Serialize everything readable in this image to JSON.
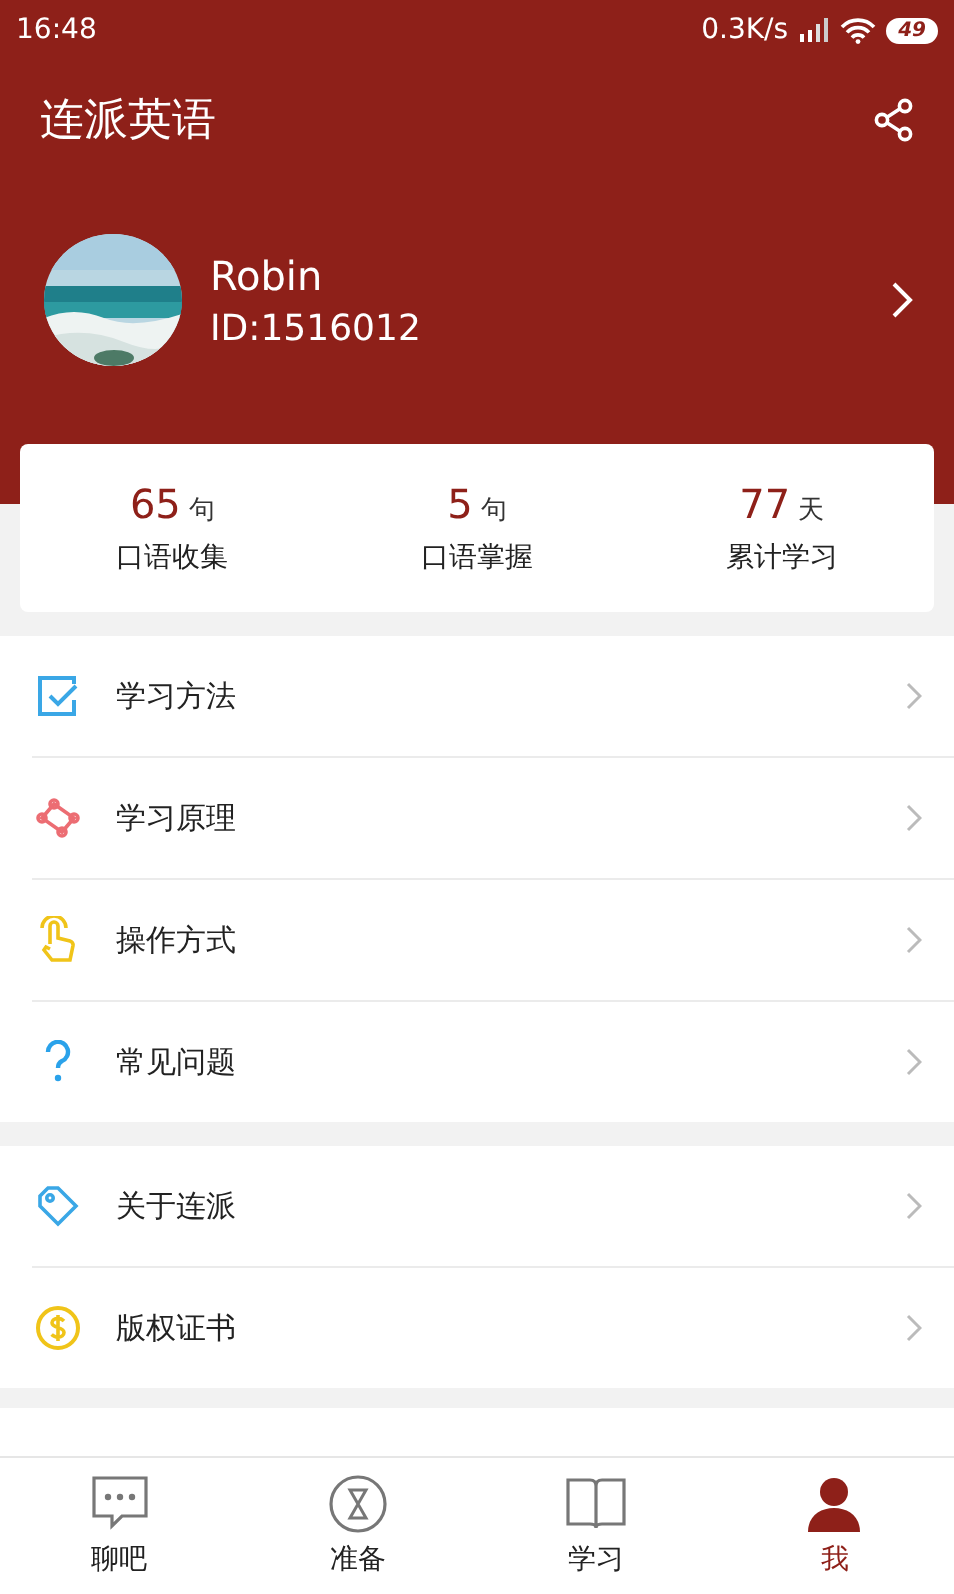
{
  "status_bar": {
    "time": "16:48",
    "net_speed": "0.3K/s",
    "battery": "49"
  },
  "header": {
    "title": "连派英语"
  },
  "profile": {
    "name": "Robin",
    "id": "ID:1516012"
  },
  "stats": [
    {
      "value": "65",
      "unit": "句",
      "label": "口语收集"
    },
    {
      "value": "5",
      "unit": "句",
      "label": "口语掌握"
    },
    {
      "value": "77",
      "unit": "天",
      "label": "累计学习"
    }
  ],
  "menu_groups": [
    [
      {
        "kind": "method",
        "label": "学习方法"
      },
      {
        "kind": "principle",
        "label": "学习原理"
      },
      {
        "kind": "operation",
        "label": "操作方式"
      },
      {
        "kind": "faq",
        "label": "常见问题"
      }
    ],
    [
      {
        "kind": "about",
        "label": "关于连派"
      },
      {
        "kind": "copyright",
        "label": "版权证书"
      }
    ]
  ],
  "tabs": [
    {
      "kind": "chat",
      "label": "聊吧",
      "selected": false
    },
    {
      "kind": "prepare",
      "label": "准备",
      "selected": false
    },
    {
      "kind": "study",
      "label": "学习",
      "selected": false
    },
    {
      "kind": "me",
      "label": "我",
      "selected": true
    }
  ]
}
